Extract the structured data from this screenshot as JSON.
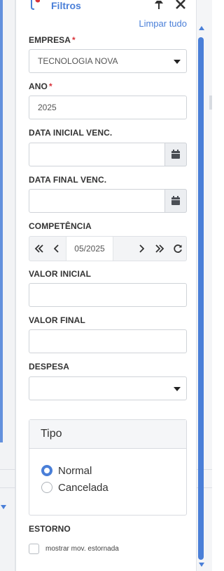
{
  "header": {
    "title": "Filtros",
    "clear_label": "Limpar tudo",
    "icons": {
      "filter": "filter-icon",
      "pin": "pin-icon",
      "close": "close-icon"
    }
  },
  "fields": {
    "empresa": {
      "label": "EMPRESA",
      "required_mark": "*",
      "value": "TECNOLOGIA NOVA"
    },
    "ano": {
      "label": "ANO",
      "required_mark": "*",
      "value": "2025"
    },
    "data_inicial": {
      "label": "DATA INICIAL VENC.",
      "value": ""
    },
    "data_final": {
      "label": "DATA FINAL VENC.",
      "value": ""
    },
    "competencia": {
      "label": "COMPETÊNCIA",
      "value": "05/2025"
    },
    "valor_inicial": {
      "label": "VALOR INICIAL",
      "value": ""
    },
    "valor_final": {
      "label": "VALOR FINAL",
      "value": ""
    },
    "despesa": {
      "label": "DESPESA",
      "value": ""
    }
  },
  "tipo": {
    "title": "Tipo",
    "options": [
      {
        "label": "Normal",
        "selected": true
      },
      {
        "label": "Cancelada",
        "selected": false
      }
    ]
  },
  "estorno": {
    "label": "ESTORNO",
    "checkbox_label": "mostrar mov. estornada",
    "checked": false
  },
  "colors": {
    "accent": "#4a7fd8",
    "required": "#d9323a",
    "border": "#cfd3d8"
  }
}
